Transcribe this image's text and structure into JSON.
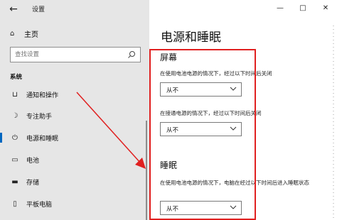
{
  "window": {
    "title": "设置",
    "controls": {
      "minimize": "—",
      "maximize": "□",
      "close": "✕"
    }
  },
  "sidebar": {
    "home_label": "主页",
    "search": {
      "placeholder": "查找设置"
    },
    "section_label": "系统",
    "items": [
      {
        "label": "通知和操作",
        "icon": "notification-icon"
      },
      {
        "label": "专注助手",
        "icon": "moon-icon"
      },
      {
        "label": "电源和睡眠",
        "icon": "power-icon",
        "selected": true
      },
      {
        "label": "电池",
        "icon": "battery-icon"
      },
      {
        "label": "存储",
        "icon": "storage-icon"
      },
      {
        "label": "平板电脑",
        "icon": "tablet-icon"
      }
    ]
  },
  "main": {
    "page_title": "电源和睡眠",
    "screen": {
      "heading": "屏幕",
      "battery_desc": "在使用电池电源的情况下，经过以下时间后关闭",
      "battery_value": "从不",
      "plugged_desc": "在接通电源的情况下，经过以下时间后关闭",
      "plugged_value": "从不"
    },
    "sleep": {
      "heading": "睡眠",
      "battery_desc": "在使用电池电源的情况下，电脑在经过以下时间后进入睡眠状态",
      "battery_value": "从不"
    }
  },
  "colors": {
    "highlight": "#e02020",
    "accent": "#0067c0",
    "sidebar_bg": "#e6e6e6"
  }
}
